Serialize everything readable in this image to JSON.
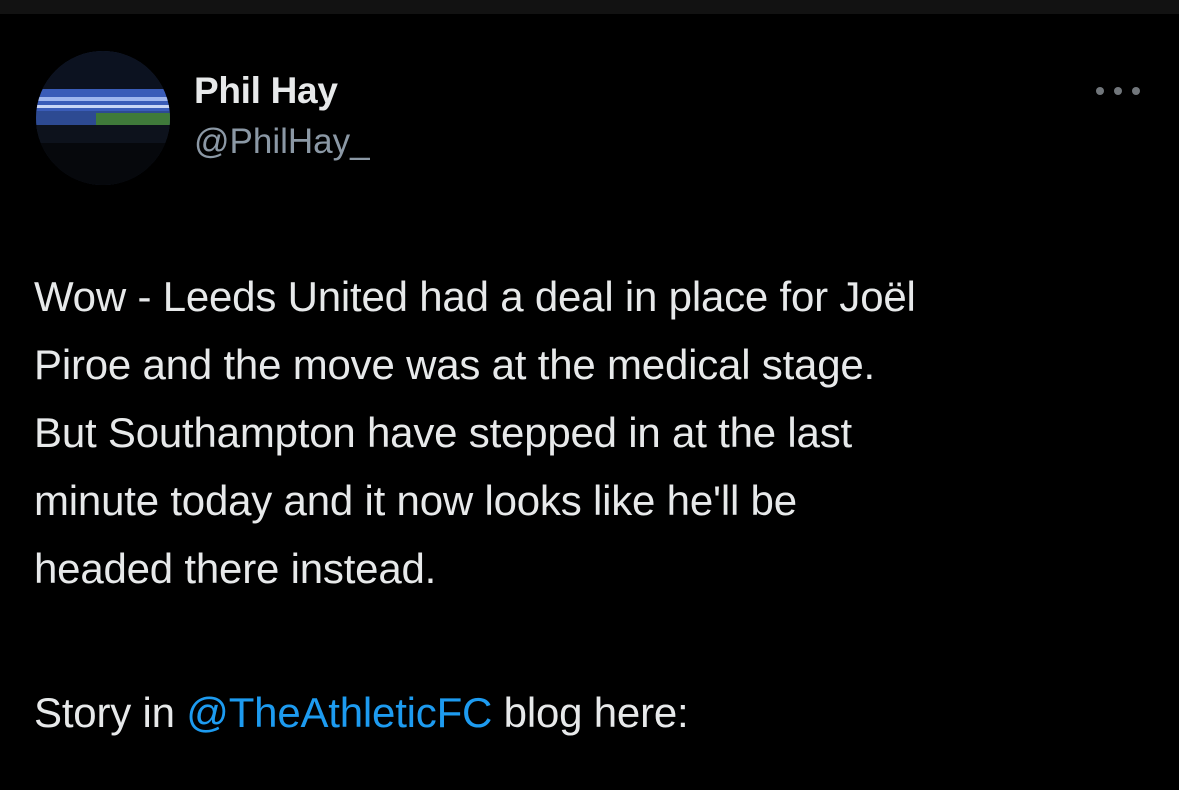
{
  "tweet": {
    "author": {
      "display_name": "Phil Hay",
      "handle": "@PhilHay_"
    },
    "more_icon": "more-horizontal-icon",
    "body_lines": [
      "Wow - Leeds United had a deal in place for Joël",
      "Piroe and the move was at the medical stage.",
      "But Southampton have stepped in at the last",
      "minute today and it now looks like he'll be",
      "headed there instead."
    ],
    "story": {
      "prefix": "Story in ",
      "mention": "@TheAthleticFC",
      "suffix": " blog here:"
    }
  },
  "colors": {
    "background": "#000000",
    "text_primary": "#e7e9ea",
    "text_secondary": "#8b98a5",
    "link": "#1d9bf0"
  }
}
